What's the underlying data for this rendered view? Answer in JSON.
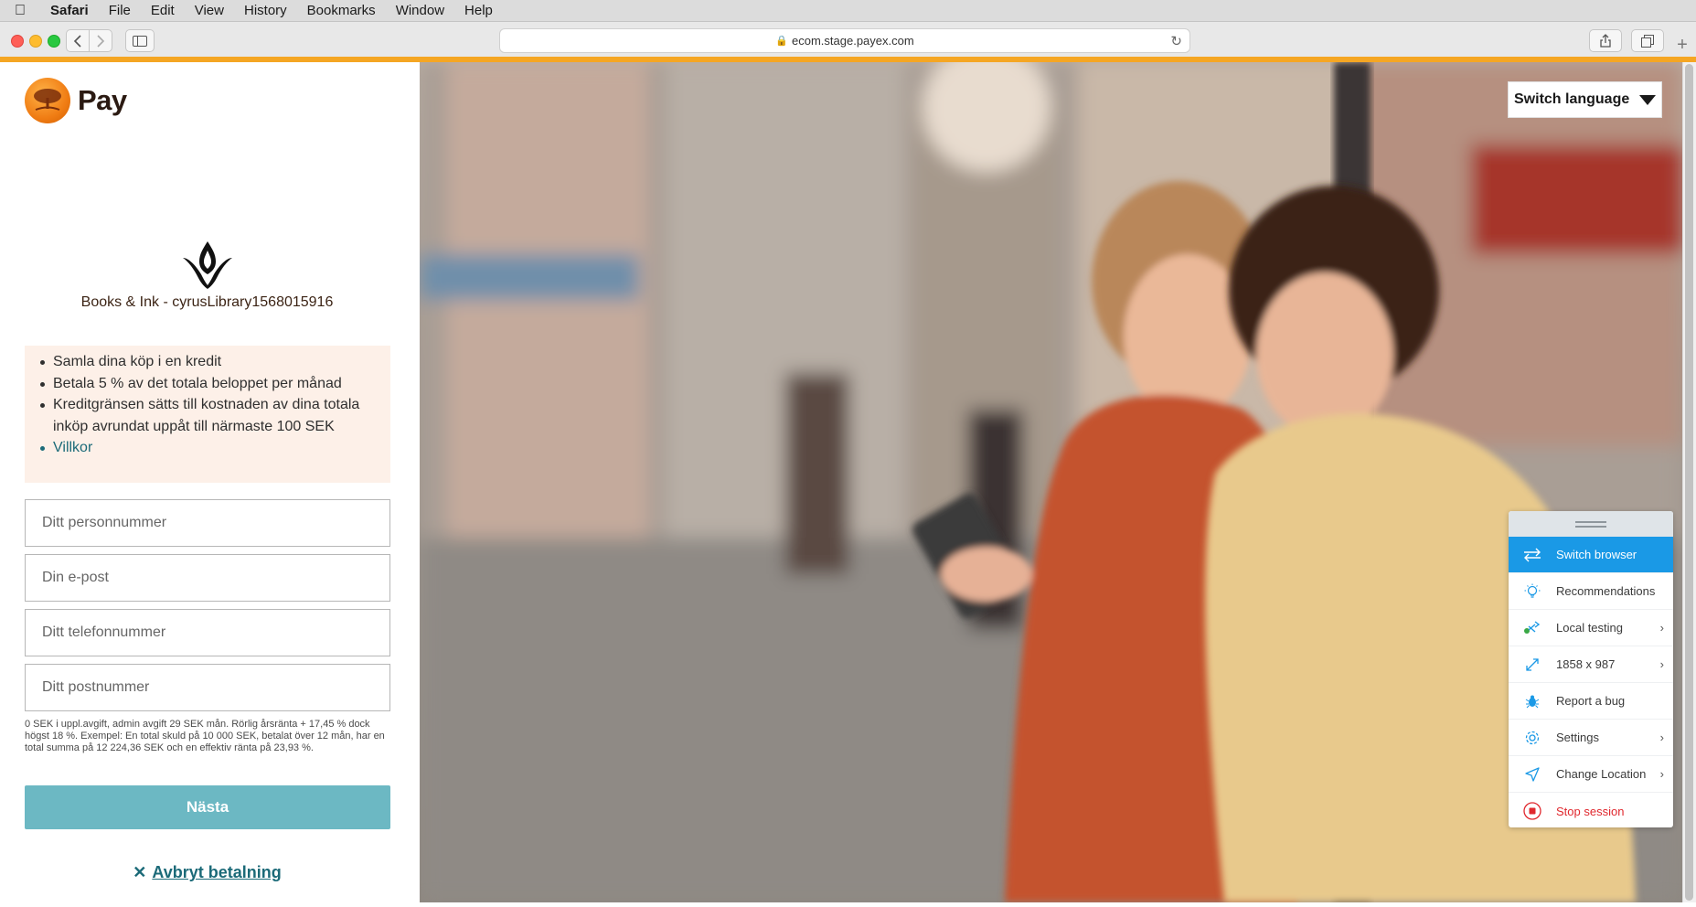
{
  "menubar": {
    "app_name": "Safari",
    "items": [
      "File",
      "Edit",
      "View",
      "History",
      "Bookmarks",
      "Window",
      "Help"
    ]
  },
  "browser": {
    "url": "ecom.stage.payex.com"
  },
  "brand": {
    "logo_text": "Pay",
    "accent": "#f07d14"
  },
  "merchant": {
    "name": "Books & Ink - cyrusLibrary1568015916"
  },
  "info": {
    "bullets": [
      "Samla dina köp i en kredit",
      "Betala 5 % av det totala beloppet per månad",
      "Kreditgränsen sätts till kostnaden av dina totala inköp avrundat uppåt till närmaste 100 SEK"
    ],
    "link": "Villkor"
  },
  "form": {
    "ssn_placeholder": "Ditt personnummer",
    "email_placeholder": "Din e-post",
    "phone_placeholder": "Ditt telefonnummer",
    "postal_placeholder": "Ditt postnummer",
    "terms": "0 SEK i uppl.avgift, admin avgift 29 SEK mån. Rörlig årsränta + 17,45 % dock högst 18 %. Exempel: En total skuld på 10 000 SEK, betalat över 12 mån, har en total summa på 12 224,36 SEK och en effektiv ränta på 23,93 %.",
    "next_label": "Nästa",
    "cancel_label": "Avbryt betalning",
    "button_color": "#6cb8c3"
  },
  "language": {
    "label": "Switch language"
  },
  "bs_panel": {
    "items": [
      {
        "label": "Switch browser",
        "icon": "switch-arrows-icon"
      },
      {
        "label": "Recommendations",
        "icon": "lightbulb-icon"
      },
      {
        "label": "Local testing",
        "icon": "local-testing-icon"
      },
      {
        "label": "1858 x 987",
        "icon": "resize-icon"
      },
      {
        "label": "Report a bug",
        "icon": "bug-icon"
      },
      {
        "label": "Settings",
        "icon": "gear-icon"
      },
      {
        "label": "Change Location",
        "icon": "location-arrow-icon"
      },
      {
        "label": "Stop session",
        "icon": "stop-icon"
      }
    ],
    "active_color": "#1a99e6",
    "stop_color": "#e0282e"
  }
}
